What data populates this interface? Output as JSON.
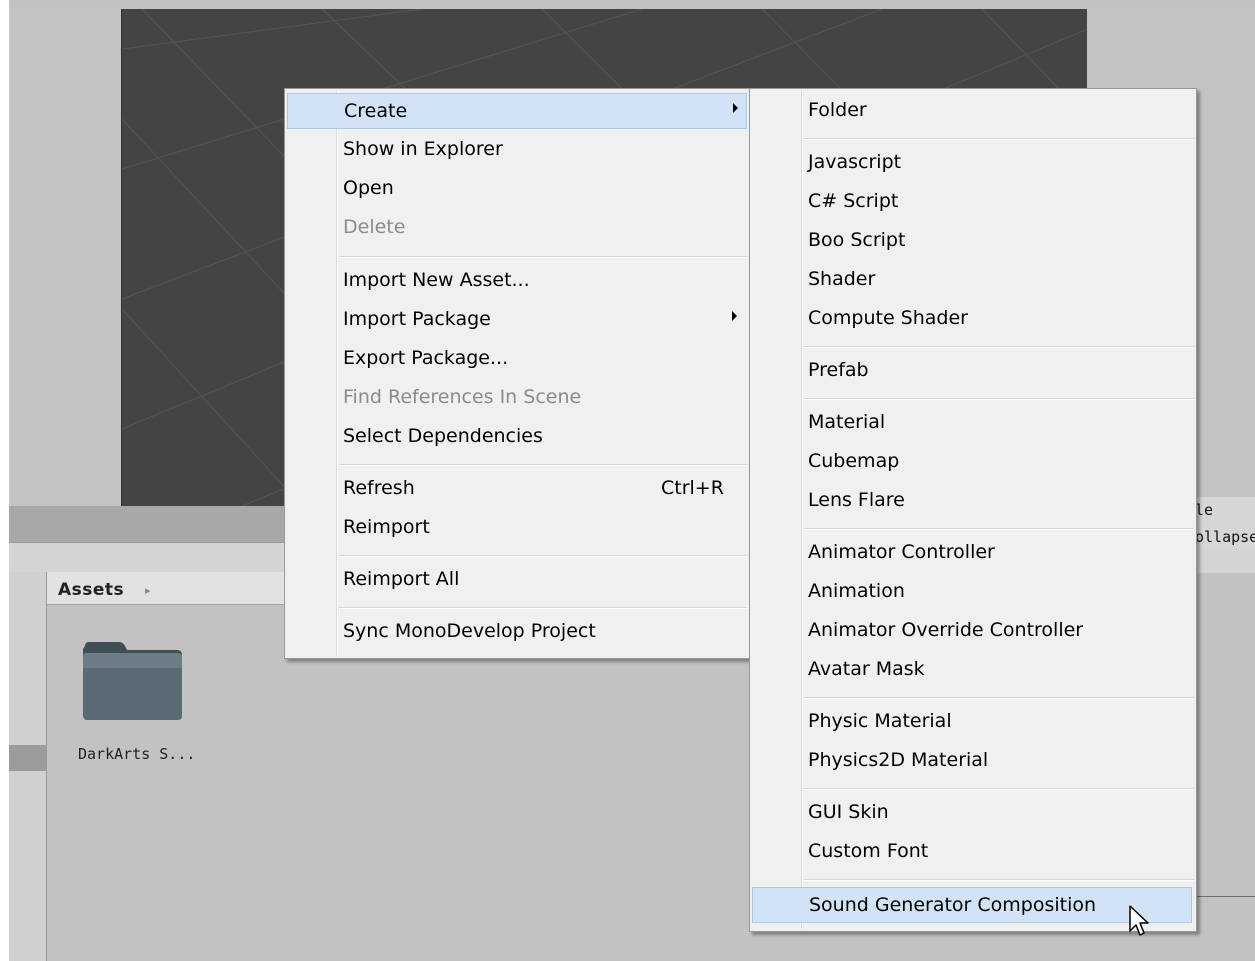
{
  "project": {
    "assets_title": "Assets",
    "assets_arrow": "▸",
    "folder_label": "DarkArts S...",
    "inspector_frag_1": "le",
    "inspector_frag_2": "ollapse"
  },
  "context_menu": {
    "items": [
      {
        "label": "Create",
        "submenu": true,
        "highlight": true
      },
      {
        "label": "Show in Explorer"
      },
      {
        "label": "Open"
      },
      {
        "label": "Delete",
        "disabled": true
      },
      {
        "label": "Import New Asset..."
      },
      {
        "label": "Import Package",
        "submenu": true
      },
      {
        "label": "Export Package..."
      },
      {
        "label": "Find References In Scene",
        "disabled": true
      },
      {
        "label": "Select Dependencies"
      },
      {
        "label": "Refresh",
        "shortcut": "Ctrl+R"
      },
      {
        "label": "Reimport"
      },
      {
        "label": "Reimport All"
      },
      {
        "label": "Sync MonoDevelop Project"
      }
    ]
  },
  "create_submenu": {
    "items": [
      {
        "label": "Folder"
      },
      {
        "label": "Javascript"
      },
      {
        "label": "C# Script"
      },
      {
        "label": "Boo Script"
      },
      {
        "label": "Shader"
      },
      {
        "label": "Compute Shader"
      },
      {
        "label": "Prefab"
      },
      {
        "label": "Material"
      },
      {
        "label": "Cubemap"
      },
      {
        "label": "Lens Flare"
      },
      {
        "label": "Animator Controller"
      },
      {
        "label": "Animation"
      },
      {
        "label": "Animator Override Controller"
      },
      {
        "label": "Avatar Mask"
      },
      {
        "label": "Physic Material"
      },
      {
        "label": "Physics2D Material"
      },
      {
        "label": "GUI Skin"
      },
      {
        "label": "Custom Font"
      },
      {
        "label": "Sound Generator Composition",
        "highlight": true
      }
    ]
  },
  "colors": {
    "highlight": "#d1e3f4",
    "menu_bg": "#f0f0f0",
    "scene_bg": "#444444"
  }
}
